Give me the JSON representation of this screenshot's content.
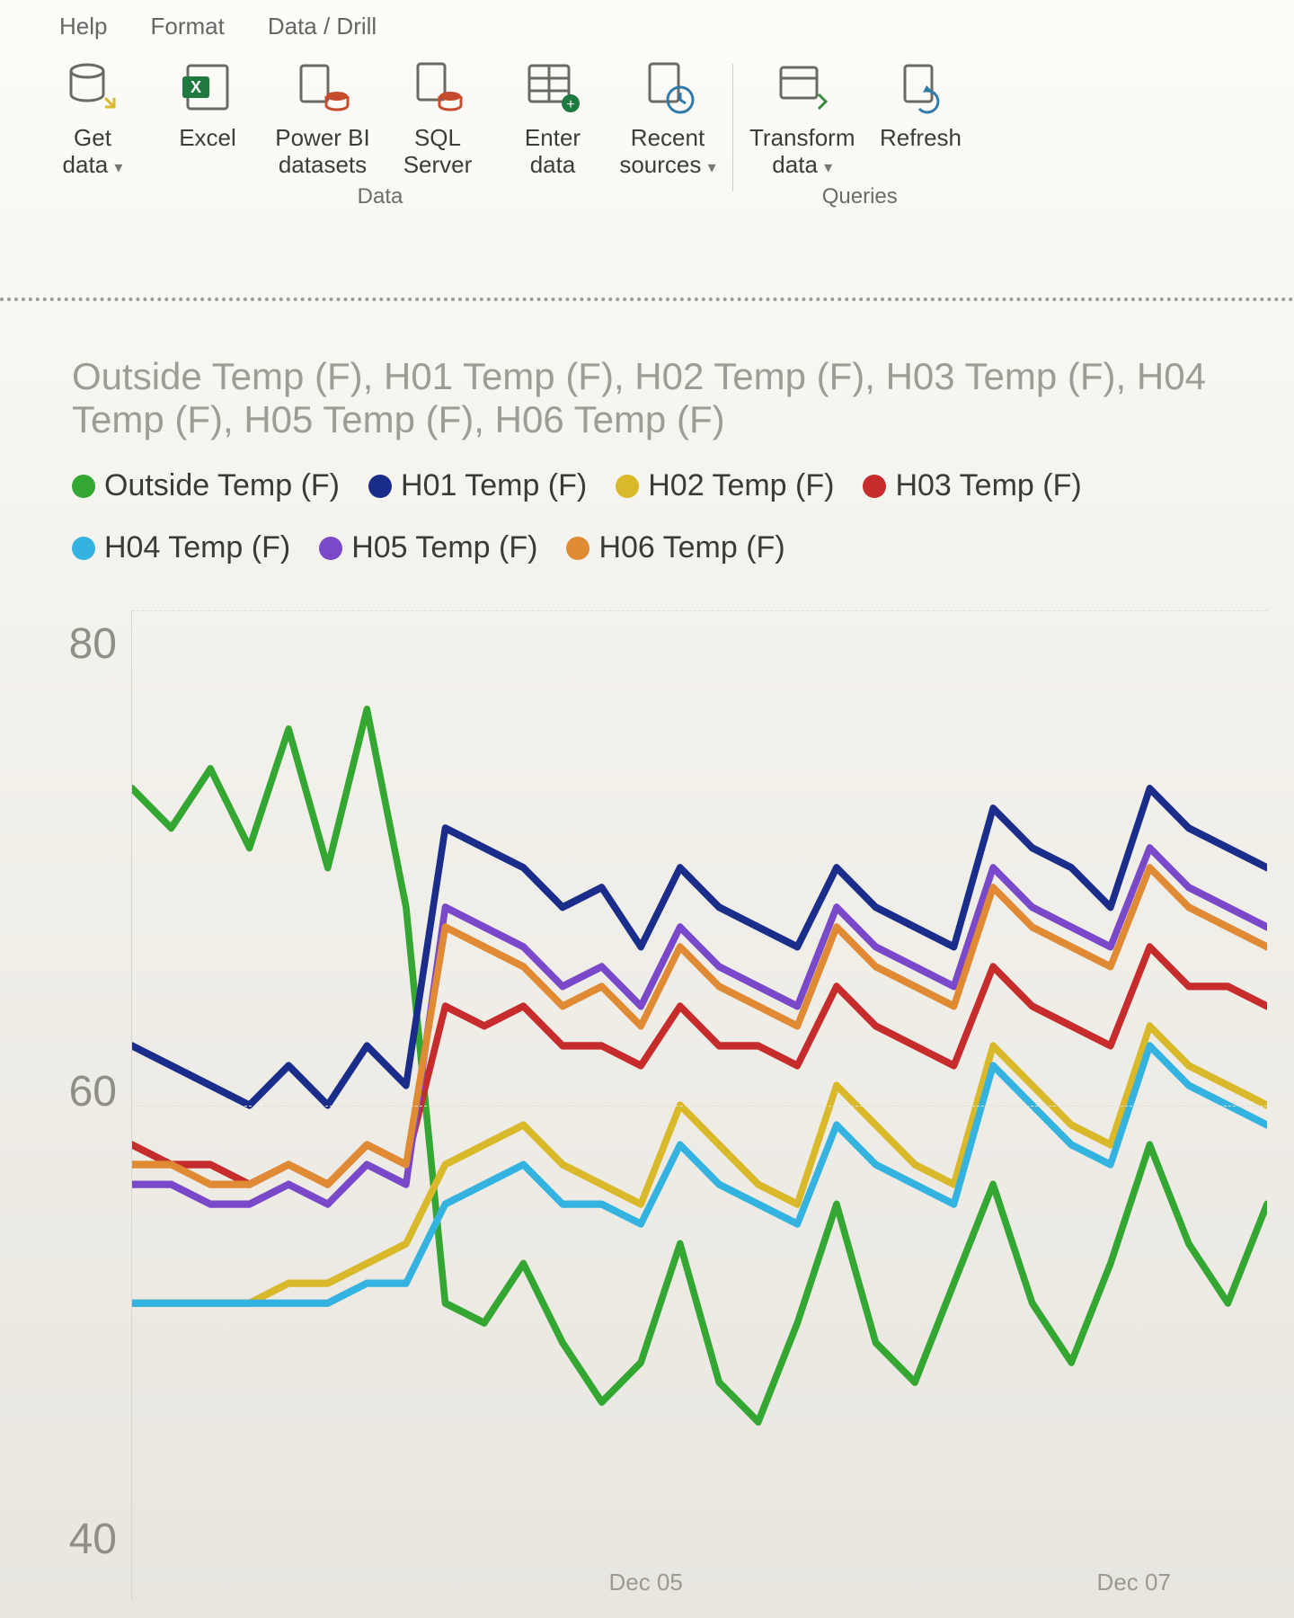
{
  "ribbon_tabs": [
    "Help",
    "Format",
    "Data / Drill"
  ],
  "ribbon": {
    "groups": [
      {
        "name": "Data",
        "items": [
          {
            "id": "get-data",
            "label": "Get\ndata",
            "has_chevron": true
          },
          {
            "id": "excel",
            "label": "Excel"
          },
          {
            "id": "powerbi",
            "label": "Power BI\ndatasets"
          },
          {
            "id": "sql",
            "label": "SQL\nServer"
          },
          {
            "id": "enter-data",
            "label": "Enter\ndata"
          },
          {
            "id": "recent",
            "label": "Recent\nsources",
            "has_chevron": true
          }
        ]
      },
      {
        "name": "Queries",
        "items": [
          {
            "id": "transform",
            "label": "Transform\ndata",
            "has_chevron": true
          },
          {
            "id": "refresh",
            "label": "Refresh"
          }
        ]
      }
    ]
  },
  "chart_data": {
    "type": "line",
    "title": "Outside Temp (F), H01 Temp (F), H02 Temp (F), H03 Temp (F), H04 Temp (F), H05 Temp (F), H06 Temp (F)",
    "ylabel": "",
    "xlabel": "",
    "ylim": [
      35,
      85
    ],
    "y_ticks": [
      80,
      60,
      40
    ],
    "x_ticks": [
      "Dec 05",
      "Dec 07"
    ],
    "x": [
      0,
      1,
      2,
      3,
      4,
      5,
      6,
      7,
      8,
      9,
      10,
      11,
      12,
      13,
      14,
      15,
      16,
      17,
      18,
      19,
      20,
      21,
      22,
      23,
      24,
      25,
      26,
      27,
      28,
      29
    ],
    "series": [
      {
        "name": "Outside Temp (F)",
        "color": "#34a632",
        "values": [
          76,
          74,
          77,
          73,
          79,
          72,
          80,
          70,
          50,
          49,
          52,
          48,
          45,
          47,
          53,
          46,
          44,
          49,
          55,
          48,
          46,
          51,
          56,
          50,
          47,
          52,
          58,
          53,
          50,
          55
        ]
      },
      {
        "name": "H01 Temp (F)",
        "color": "#1a2d8a",
        "values": [
          63,
          62,
          61,
          60,
          62,
          60,
          63,
          61,
          74,
          73,
          72,
          70,
          71,
          68,
          72,
          70,
          69,
          68,
          72,
          70,
          69,
          68,
          75,
          73,
          72,
          70,
          76,
          74,
          73,
          72
        ]
      },
      {
        "name": "H02 Temp (F)",
        "color": "#d9b82a",
        "values": [
          50,
          50,
          50,
          50,
          51,
          51,
          52,
          53,
          57,
          58,
          59,
          57,
          56,
          55,
          60,
          58,
          56,
          55,
          61,
          59,
          57,
          56,
          63,
          61,
          59,
          58,
          64,
          62,
          61,
          60
        ]
      },
      {
        "name": "H03 Temp (F)",
        "color": "#c62c2c",
        "values": [
          58,
          57,
          57,
          56,
          57,
          56,
          58,
          57,
          65,
          64,
          65,
          63,
          63,
          62,
          65,
          63,
          63,
          62,
          66,
          64,
          63,
          62,
          67,
          65,
          64,
          63,
          68,
          66,
          66,
          65
        ]
      },
      {
        "name": "H04 Temp (F)",
        "color": "#34b3e0",
        "values": [
          50,
          50,
          50,
          50,
          50,
          50,
          51,
          51,
          55,
          56,
          57,
          55,
          55,
          54,
          58,
          56,
          55,
          54,
          59,
          57,
          56,
          55,
          62,
          60,
          58,
          57,
          63,
          61,
          60,
          59
        ]
      },
      {
        "name": "H05 Temp (F)",
        "color": "#7a49c9",
        "values": [
          56,
          56,
          55,
          55,
          56,
          55,
          57,
          56,
          70,
          69,
          68,
          66,
          67,
          65,
          69,
          67,
          66,
          65,
          70,
          68,
          67,
          66,
          72,
          70,
          69,
          68,
          73,
          71,
          70,
          69
        ]
      },
      {
        "name": "H06 Temp (F)",
        "color": "#e08a34",
        "values": [
          57,
          57,
          56,
          56,
          57,
          56,
          58,
          57,
          69,
          68,
          67,
          65,
          66,
          64,
          68,
          66,
          65,
          64,
          69,
          67,
          66,
          65,
          71,
          69,
          68,
          67,
          72,
          70,
          69,
          68
        ]
      }
    ],
    "legend": [
      {
        "label": "Outside Temp (F)",
        "color": "#34a632"
      },
      {
        "label": "H01 Temp (F)",
        "color": "#1a2d8a"
      },
      {
        "label": "H02 Temp (F)",
        "color": "#d9b82a"
      },
      {
        "label": "H03 Temp (F)",
        "color": "#c62c2c"
      },
      {
        "label": "H04 Temp (F)",
        "color": "#34b3e0"
      },
      {
        "label": "H05 Temp (F)",
        "color": "#7a49c9"
      },
      {
        "label": "H06 Temp (F)",
        "color": "#e08a34"
      }
    ]
  }
}
